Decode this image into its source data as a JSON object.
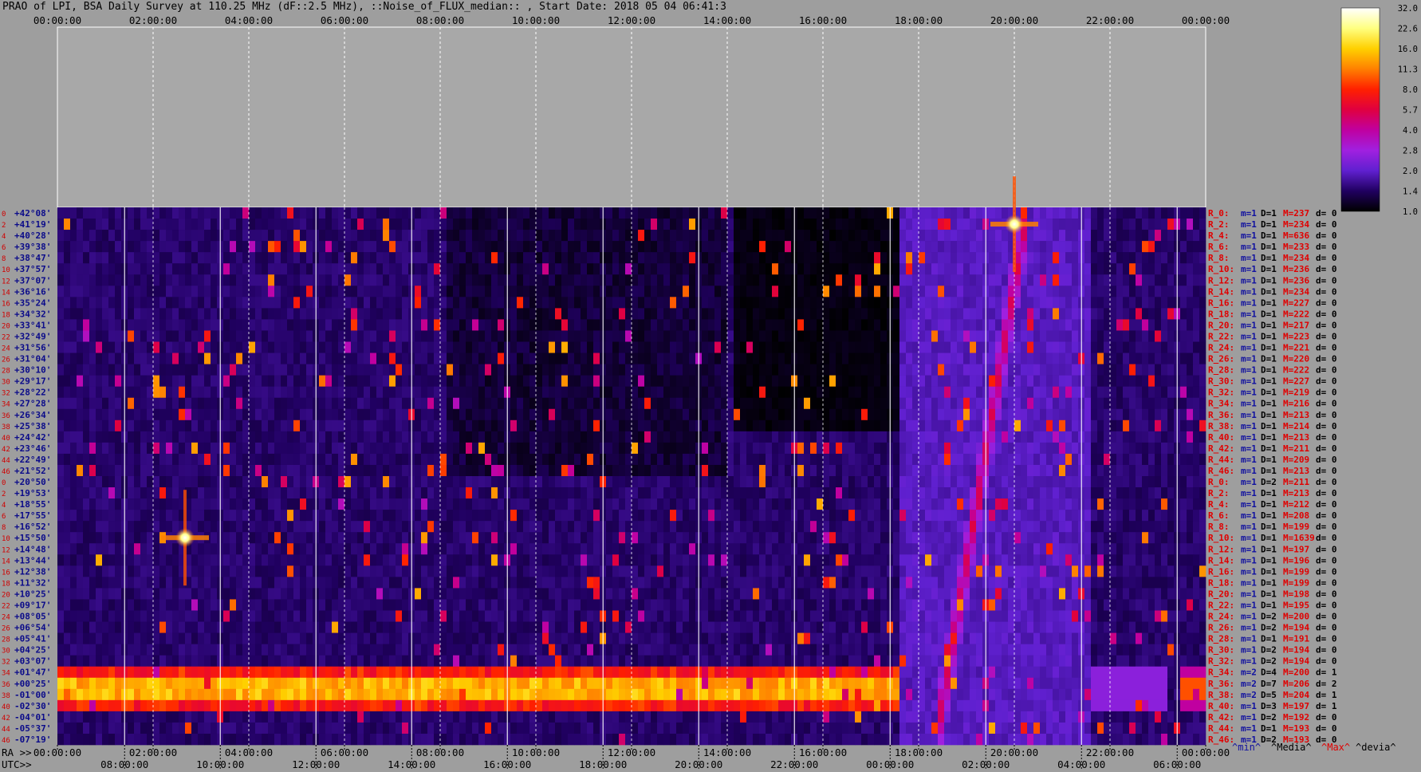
{
  "title": "PRAO of LPI, BSA Daily Survey at 110.25 MHz (dF::2.5 MHz), ::Noise_of_FLUX_median:: , Start Date: 2018 05 04 06:41:3",
  "axes": {
    "ra_prefix": "RA >>",
    "utc_prefix": "UTC>>",
    "ra_ticks": [
      "00:00:00",
      "02:00:00",
      "04:00:00",
      "06:00:00",
      "08:00:00",
      "10:00:00",
      "12:00:00",
      "14:00:00",
      "16:00:00",
      "18:00:00",
      "20:00:00",
      "22:00:00",
      "00:00:00"
    ],
    "utc_ticks": [
      "08:00:00",
      "10:00:00",
      "12:00:00",
      "14:00:00",
      "16:00:00",
      "18:00:00",
      "20:00:00",
      "22:00:00",
      "00:00:00",
      "02:00:00",
      "04:00:00",
      "06:00:00"
    ]
  },
  "colorbar": {
    "labels": [
      "32.0",
      "22.6",
      "16.0",
      "11.3",
      "8.0",
      "5.7",
      "4.0",
      "2.8",
      "2.0",
      "1.4",
      "1.0"
    ],
    "colors": [
      "#ffffff",
      "#ffff80",
      "#ffd000",
      "#ff8000",
      "#ff2000",
      "#e00040",
      "#c000a0",
      "#a020e0",
      "#6020d0",
      "#200060",
      "#000000"
    ]
  },
  "legend": {
    "min": "^min^",
    "media": "^Media^",
    "max": "^Max^",
    "devia": "^devia^",
    "min_color": "#1010a0",
    "max_color": "#e00000"
  },
  "chart_data": {
    "type": "heatmap",
    "title": "PRAO of LPI, BSA Daily Survey at 110.25 MHz (dF::2.5 MHz), ::Noise_of_FLUX_median:: , Start Date: 2018 05 04 06:41:3",
    "x_axis": "RA (top, 00:00:00 to 24:00:00) and UTC (bottom)",
    "y_axis": "Declination per beam",
    "declinations": [
      "+42°08'",
      "+41°19'",
      "+40°28'",
      "+39°38'",
      "+38°47'",
      "+37°57'",
      "+37°07'",
      "+36°16'",
      "+35°24'",
      "+34°32'",
      "+33°41'",
      "+32°49'",
      "+31°56'",
      "+31°04'",
      "+30°10'",
      "+29°17'",
      "+28°22'",
      "+27°28'",
      "+26°34'",
      "+25°38'",
      "+24°42'",
      "+23°46'",
      "+22°49'",
      "+21°52'",
      "+20°50'",
      "+19°53'",
      "+18°55'",
      "+17°55'",
      "+16°52'",
      "+15°50'",
      "+14°48'",
      "+13°44'",
      "+12°38'",
      "+11°32'",
      "+10°25'",
      "+09°17'",
      "+08°05'",
      "+06°54'",
      "+05°41'",
      "+04°25'",
      "+03°07'",
      "+01°47'",
      "+00°25'",
      "-01°00'",
      "-02°30'",
      "-04°01'",
      "-05°37'",
      "-07°19'"
    ],
    "row_indices": [
      "0",
      "2",
      "4",
      "6",
      "8",
      "10",
      "12",
      "14",
      "16",
      "18",
      "20",
      "22",
      "24",
      "26",
      "28",
      "30",
      "32",
      "34",
      "36",
      "38",
      "40",
      "42",
      "44",
      "46",
      "0",
      "2",
      "4",
      "6",
      "8",
      "10",
      "12",
      "14",
      "16",
      "18",
      "20",
      "22",
      "24",
      "26",
      "28",
      "30",
      "32",
      "34",
      "36",
      "38",
      "40",
      "42",
      "44",
      "46"
    ],
    "stats": [
      {
        "r": "R_0:",
        "m": "m=1",
        "D": "D=1",
        "M": "M=237",
        "d": "d= 0"
      },
      {
        "r": "R_2:",
        "m": "m=1",
        "D": "D=1",
        "M": "M=234",
        "d": "d= 0"
      },
      {
        "r": "R_4:",
        "m": "m=1",
        "D": "D=1",
        "M": "M=636",
        "d": "d= 0"
      },
      {
        "r": "R_6:",
        "m": "m=1",
        "D": "D=1",
        "M": "M=233",
        "d": "d= 0"
      },
      {
        "r": "R_8:",
        "m": "m=1",
        "D": "D=1",
        "M": "M=234",
        "d": "d= 0"
      },
      {
        "r": "R_10:",
        "m": "m=1",
        "D": "D=1",
        "M": "M=236",
        "d": "d= 0"
      },
      {
        "r": "R_12:",
        "m": "m=1",
        "D": "D=1",
        "M": "M=236",
        "d": "d= 0"
      },
      {
        "r": "R_14:",
        "m": "m=1",
        "D": "D=1",
        "M": "M=234",
        "d": "d= 0"
      },
      {
        "r": "R_16:",
        "m": "m=1",
        "D": "D=1",
        "M": "M=227",
        "d": "d= 0"
      },
      {
        "r": "R_18:",
        "m": "m=1",
        "D": "D=1",
        "M": "M=222",
        "d": "d= 0"
      },
      {
        "r": "R_20:",
        "m": "m=1",
        "D": "D=1",
        "M": "M=217",
        "d": "d= 0"
      },
      {
        "r": "R_22:",
        "m": "m=1",
        "D": "D=1",
        "M": "M=223",
        "d": "d= 0"
      },
      {
        "r": "R_24:",
        "m": "m=1",
        "D": "D=1",
        "M": "M=221",
        "d": "d= 0"
      },
      {
        "r": "R_26:",
        "m": "m=1",
        "D": "D=1",
        "M": "M=220",
        "d": "d= 0"
      },
      {
        "r": "R_28:",
        "m": "m=1",
        "D": "D=1",
        "M": "M=222",
        "d": "d= 0"
      },
      {
        "r": "R_30:",
        "m": "m=1",
        "D": "D=1",
        "M": "M=227",
        "d": "d= 0"
      },
      {
        "r": "R_32:",
        "m": "m=1",
        "D": "D=1",
        "M": "M=219",
        "d": "d= 0"
      },
      {
        "r": "R_34:",
        "m": "m=1",
        "D": "D=1",
        "M": "M=216",
        "d": "d= 0"
      },
      {
        "r": "R_36:",
        "m": "m=1",
        "D": "D=1",
        "M": "M=213",
        "d": "d= 0"
      },
      {
        "r": "R_38:",
        "m": "m=1",
        "D": "D=1",
        "M": "M=214",
        "d": "d= 0"
      },
      {
        "r": "R_40:",
        "m": "m=1",
        "D": "D=1",
        "M": "M=213",
        "d": "d= 0"
      },
      {
        "r": "R_42:",
        "m": "m=1",
        "D": "D=1",
        "M": "M=211",
        "d": "d= 0"
      },
      {
        "r": "R_44:",
        "m": "m=1",
        "D": "D=1",
        "M": "M=209",
        "d": "d= 0"
      },
      {
        "r": "R_46:",
        "m": "m=1",
        "D": "D=1",
        "M": "M=213",
        "d": "d= 0"
      },
      {
        "r": "R_0:",
        "m": "m=1",
        "D": "D=2",
        "M": "M=211",
        "d": "d= 0"
      },
      {
        "r": "R_2:",
        "m": "m=1",
        "D": "D=1",
        "M": "M=213",
        "d": "d= 0"
      },
      {
        "r": "R_4:",
        "m": "m=1",
        "D": "D=1",
        "M": "M=212",
        "d": "d= 0"
      },
      {
        "r": "R_6:",
        "m": "m=1",
        "D": "D=1",
        "M": "M=208",
        "d": "d= 0"
      },
      {
        "r": "R_8:",
        "m": "m=1",
        "D": "D=1",
        "M": "M=199",
        "d": "d= 0"
      },
      {
        "r": "R_10:",
        "m": "m=1",
        "D": "D=1",
        "M": "M=1639",
        "d": "d= 0"
      },
      {
        "r": "R_12:",
        "m": "m=1",
        "D": "D=1",
        "M": "M=197",
        "d": "d= 0"
      },
      {
        "r": "R_14:",
        "m": "m=1",
        "D": "D=1",
        "M": "M=196",
        "d": "d= 0"
      },
      {
        "r": "R_16:",
        "m": "m=1",
        "D": "D=1",
        "M": "M=199",
        "d": "d= 0"
      },
      {
        "r": "R_18:",
        "m": "m=1",
        "D": "D=1",
        "M": "M=199",
        "d": "d= 0"
      },
      {
        "r": "R_20:",
        "m": "m=1",
        "D": "D=1",
        "M": "M=198",
        "d": "d= 0"
      },
      {
        "r": "R_22:",
        "m": "m=1",
        "D": "D=1",
        "M": "M=195",
        "d": "d= 0"
      },
      {
        "r": "R_24:",
        "m": "m=1",
        "D": "D=2",
        "M": "M=200",
        "d": "d= 0"
      },
      {
        "r": "R_26:",
        "m": "m=1",
        "D": "D=2",
        "M": "M=194",
        "d": "d= 0"
      },
      {
        "r": "R_28:",
        "m": "m=1",
        "D": "D=1",
        "M": "M=191",
        "d": "d= 0"
      },
      {
        "r": "R_30:",
        "m": "m=1",
        "D": "D=2",
        "M": "M=194",
        "d": "d= 0"
      },
      {
        "r": "R_32:",
        "m": "m=1",
        "D": "D=2",
        "M": "M=194",
        "d": "d= 0"
      },
      {
        "r": "R_34:",
        "m": "m=2",
        "D": "D=4",
        "M": "M=200",
        "d": "d= 1"
      },
      {
        "r": "R_36:",
        "m": "m=2",
        "D": "D=7",
        "M": "M=206",
        "d": "d= 2"
      },
      {
        "r": "R_38:",
        "m": "m=2",
        "D": "D=5",
        "M": "M=204",
        "d": "d= 1"
      },
      {
        "r": "R_40:",
        "m": "m=1",
        "D": "D=3",
        "M": "M=197",
        "d": "d= 1"
      },
      {
        "r": "R_42:",
        "m": "m=1",
        "D": "D=2",
        "M": "M=192",
        "d": "d= 0"
      },
      {
        "r": "R_44:",
        "m": "m=1",
        "D": "D=1",
        "M": "M=193",
        "d": "d= 0"
      },
      {
        "r": "R_46:",
        "m": "m=1",
        "D": "D=2",
        "M": "M=193",
        "d": "d= 0"
      }
    ],
    "bright_band_rows": [
      41,
      42,
      43,
      44
    ],
    "notable_features": [
      {
        "label": "bright-source-cross",
        "ra": "02:40",
        "row": 29
      },
      {
        "label": "bright-source-cross",
        "ra": "20:00",
        "row": 1
      },
      {
        "label": "galactic-plane-arc",
        "ra_start": "17:30",
        "ra_end": "21:30"
      }
    ]
  }
}
